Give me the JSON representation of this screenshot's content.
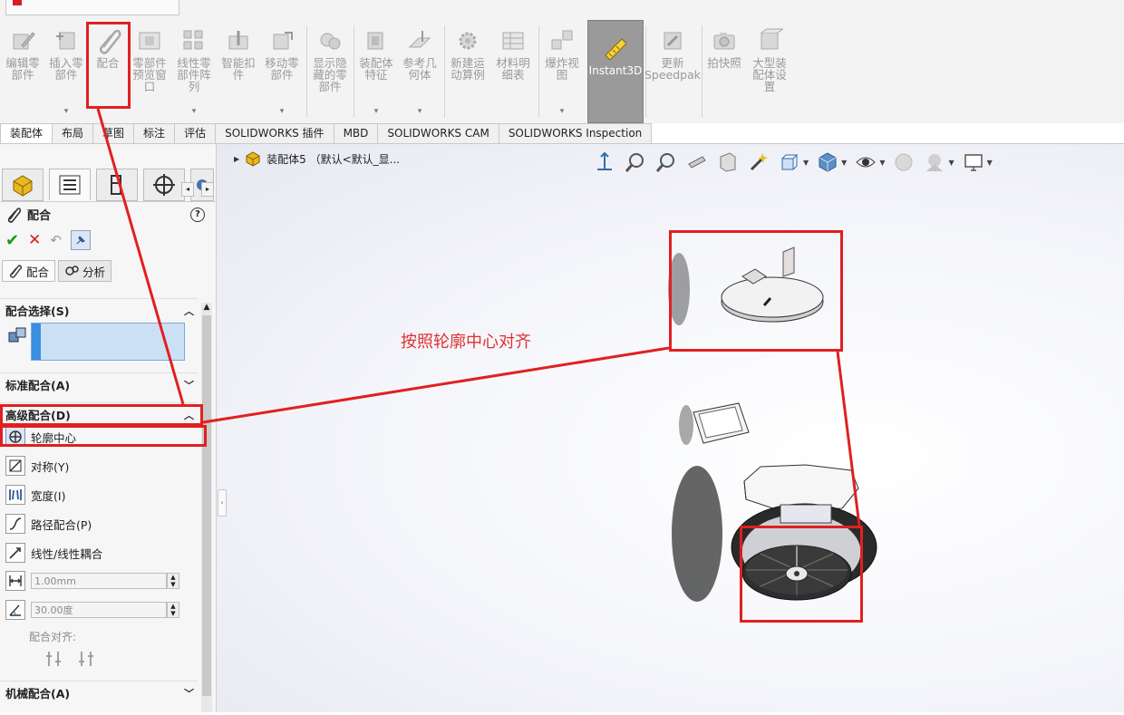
{
  "ribbon": {
    "buttons": [
      {
        "id": "edit-component",
        "label": "编辑零\n部件",
        "dropdown": false
      },
      {
        "id": "insert-component",
        "label": "插入零\n部件",
        "dropdown": true
      },
      {
        "id": "mate",
        "label": "配合",
        "dropdown": false
      },
      {
        "id": "component-preview",
        "label": "零部件\n预览窗\n口",
        "dropdown": false
      },
      {
        "id": "linear-pattern",
        "label": "线性零\n部件阵\n列",
        "dropdown": true
      },
      {
        "id": "smart-fasteners",
        "label": "智能扣\n件",
        "dropdown": false
      },
      {
        "id": "move-component",
        "label": "移动零\n部件",
        "dropdown": true
      },
      {
        "id": "show-hidden",
        "label": "显示隐\n藏的零\n部件",
        "dropdown": false
      },
      {
        "id": "assembly-features",
        "label": "装配体\n特征",
        "dropdown": true
      },
      {
        "id": "reference-geometry",
        "label": "参考几\n何体",
        "dropdown": true
      },
      {
        "id": "new-motion-study",
        "label": "新建运\n动算例",
        "dropdown": false
      },
      {
        "id": "bill-of-materials",
        "label": "材料明\n细表",
        "dropdown": false
      },
      {
        "id": "exploded-view",
        "label": "爆炸视\n图",
        "dropdown": true
      },
      {
        "id": "instant3d",
        "label": "Instant3D",
        "dropdown": false
      },
      {
        "id": "update-speedpak",
        "label": "更新\nSpeedpak",
        "dropdown": false
      },
      {
        "id": "snapshot",
        "label": "拍快照",
        "dropdown": false
      },
      {
        "id": "large-assembly",
        "label": "大型装\n配体设\n置",
        "dropdown": false
      }
    ]
  },
  "tabs": [
    "装配体",
    "布局",
    "草图",
    "标注",
    "评估",
    "SOLIDWORKS 插件",
    "MBD",
    "SOLIDWORKS CAM",
    "SOLIDWORKS Inspection"
  ],
  "tree": {
    "label": "装配体5 （默认<默认_显..."
  },
  "panel": {
    "title": "配合",
    "subtabs": {
      "mates": "配合",
      "analysis": "分析"
    },
    "sections": {
      "mate_selections": "配合选择(S)",
      "standard_mates": "标准配合(A)",
      "advanced_mates": "高级配合(D)",
      "mechanical_mates": "机械配合(A)"
    },
    "advanced_items": [
      {
        "label": "轮廓中心",
        "selected": true
      },
      {
        "label": "对称(Y)",
        "selected": false
      },
      {
        "label": "宽度(I)",
        "selected": false
      },
      {
        "label": "路径配合(P)",
        "selected": false
      },
      {
        "label": "线性/线性耦合",
        "selected": false
      }
    ],
    "distance_value": "1.00mm",
    "angle_value": "30.00度",
    "alignment_label": "配合对齐:"
  },
  "annotation": {
    "text": "按照轮廓中心对齐",
    "color": "#e02020"
  },
  "colors": {
    "accent_selection": "#3b8fe0",
    "instant3d_bg": "#9a9a9a"
  }
}
